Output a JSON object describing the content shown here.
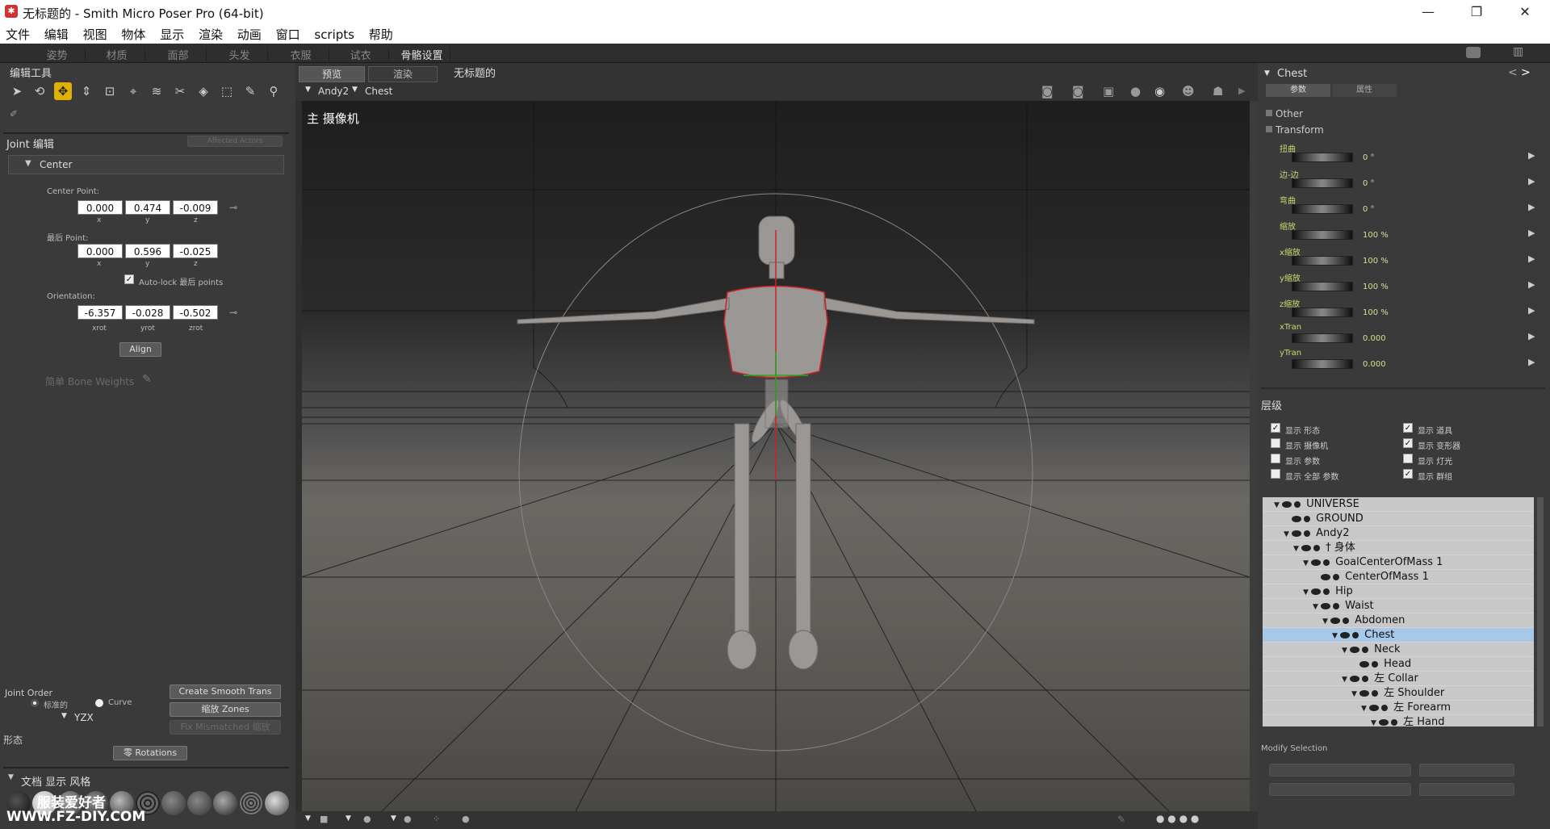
{
  "window": {
    "title": "无标题的 - Smith Micro Poser Pro  (64-bit)",
    "min": "—",
    "restore": "❐",
    "close": "✕"
  },
  "menu": [
    "文件",
    "编辑",
    "视图",
    "物体",
    "显示",
    "渲染",
    "动画",
    "窗口",
    "scripts",
    "帮助"
  ],
  "rooms": [
    "姿势",
    "材质",
    "面部",
    "头发",
    "衣服",
    "试衣",
    "骨骼设置"
  ],
  "editing_tools": {
    "title": "编辑工具"
  },
  "joint": {
    "title": "Joint 编辑",
    "affected": "Affected Actors",
    "section": "Center",
    "center_label": "Center Point:",
    "center": [
      "0.000",
      "0.474",
      "-0.009"
    ],
    "end_label": "最后 Point:",
    "end": [
      "0.000",
      "0.596",
      "-0.025"
    ],
    "xyz": [
      "x",
      "y",
      "z"
    ],
    "autolock": "Auto-lock 最后 points",
    "orient_label": "Orientation:",
    "orient": [
      "-6.357",
      "-0.028",
      "-0.502"
    ],
    "rot": [
      "xrot",
      "yrot",
      "zrot"
    ],
    "align": "Align",
    "bone_weights": "简单 Bone Weights",
    "order_label": "Joint Order",
    "opt1": "标准的",
    "opt2": "Curve",
    "order": "YZX",
    "smooth": "Create Smooth Trans",
    "zones": "缩放 Zones",
    "fix": "Fix Mismatched 缩放"
  },
  "shape": {
    "title": "形态",
    "rotations": "零 Rotations"
  },
  "doc_style": {
    "title": "文档 显示 风格"
  },
  "watermark": {
    "line1": "服装爱好者",
    "line2": "WWW.FZ-DIY.COM"
  },
  "viewport": {
    "tab1": "预览",
    "tab2": "渲染",
    "doc": "无标题的",
    "figure": "Andy2",
    "part": "Chest",
    "camera": "主 摄像机"
  },
  "params": {
    "title": "Chest",
    "tab1": "参数",
    "tab2": "属性",
    "group1": "Other",
    "group2": "Transform",
    "rows": [
      {
        "name": "扭曲",
        "value": "0 °"
      },
      {
        "name": "边-边",
        "value": "0 °"
      },
      {
        "name": "弯曲",
        "value": "0 °"
      },
      {
        "name": "缩放",
        "value": "100 %"
      },
      {
        "name": "x缩放",
        "value": "100 %"
      },
      {
        "name": "y缩放",
        "value": "100 %"
      },
      {
        "name": "z缩放",
        "value": "100 %"
      },
      {
        "name": "xTran",
        "value": "0.000"
      },
      {
        "name": "yTran",
        "value": "0.000"
      }
    ]
  },
  "hierarchy": {
    "title": "层级",
    "checks": [
      {
        "label": "显示 形态",
        "checked": true
      },
      {
        "label": "显示 道具",
        "checked": true
      },
      {
        "label": "显示 摄像机",
        "checked": false
      },
      {
        "label": "显示 变形器",
        "checked": true
      },
      {
        "label": "显示 参数",
        "checked": false
      },
      {
        "label": "显示 灯光",
        "checked": false
      },
      {
        "label": "显示 全部 参数",
        "checked": false
      },
      {
        "label": "显示 群组",
        "checked": true
      }
    ],
    "tree": [
      {
        "label": "UNIVERSE",
        "indent": 0,
        "twist": true
      },
      {
        "label": "GROUND",
        "indent": 1,
        "twist": false
      },
      {
        "label": "Andy2",
        "indent": 1,
        "twist": true
      },
      {
        "label": "† 身体",
        "indent": 2,
        "twist": true
      },
      {
        "label": "GoalCenterOfMass 1",
        "indent": 3,
        "twist": true
      },
      {
        "label": "CenterOfMass 1",
        "indent": 4,
        "twist": false
      },
      {
        "label": "Hip",
        "indent": 3,
        "twist": true
      },
      {
        "label": "Waist",
        "indent": 4,
        "twist": true
      },
      {
        "label": "Abdomen",
        "indent": 5,
        "twist": true
      },
      {
        "label": "Chest",
        "indent": 6,
        "twist": true,
        "selected": true
      },
      {
        "label": "Neck",
        "indent": 7,
        "twist": true
      },
      {
        "label": "Head",
        "indent": 8,
        "twist": false
      },
      {
        "label": "左 Collar",
        "indent": 7,
        "twist": true
      },
      {
        "label": "左 Shoulder",
        "indent": 8,
        "twist": true
      },
      {
        "label": "左 Forearm",
        "indent": 9,
        "twist": true
      },
      {
        "label": "左 Hand",
        "indent": 10,
        "twist": true
      }
    ],
    "modify": "Modify Selection"
  }
}
